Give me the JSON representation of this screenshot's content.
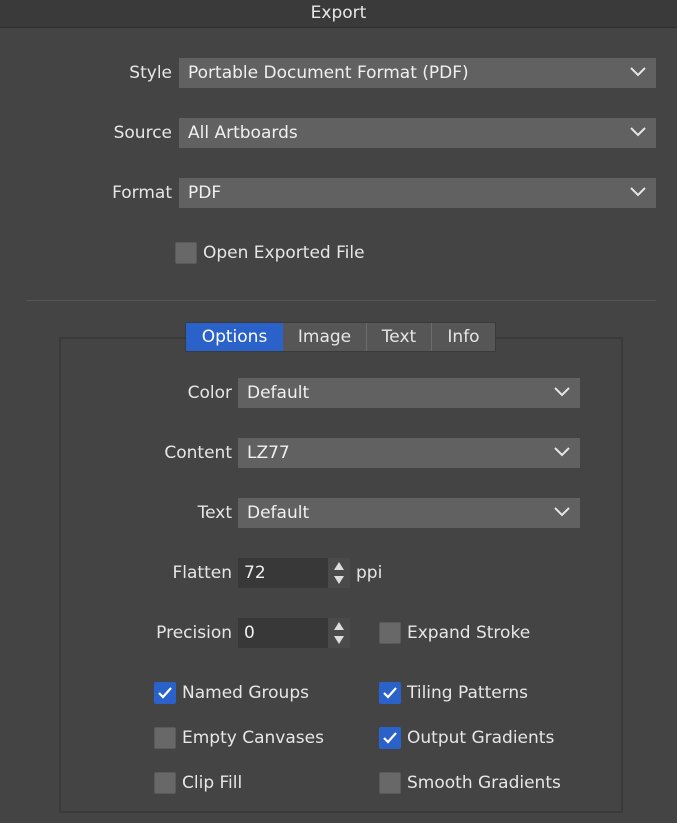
{
  "window": {
    "title": "Export"
  },
  "top": {
    "style": {
      "label": "Style",
      "value": "Portable Document Format (PDF)"
    },
    "source": {
      "label": "Source",
      "value": "All Artboards"
    },
    "format": {
      "label": "Format",
      "value": "PDF"
    },
    "open_exported": {
      "label": "Open Exported File",
      "checked": false
    }
  },
  "tabs": [
    {
      "label": "Options",
      "active": true
    },
    {
      "label": "Image",
      "active": false
    },
    {
      "label": "Text",
      "active": false
    },
    {
      "label": "Info",
      "active": false
    }
  ],
  "options": {
    "color": {
      "label": "Color",
      "value": "Default"
    },
    "content": {
      "label": "Content",
      "value": "LZ77"
    },
    "text": {
      "label": "Text",
      "value": "Default"
    },
    "flatten": {
      "label": "Flatten",
      "value": "72",
      "unit": "ppi"
    },
    "precision": {
      "label": "Precision",
      "value": "0"
    },
    "expand_stroke": {
      "label": "Expand Stroke",
      "checked": false
    },
    "named_groups": {
      "label": "Named Groups",
      "checked": true
    },
    "tiling_patterns": {
      "label": "Tiling Patterns",
      "checked": true
    },
    "empty_canvases": {
      "label": "Empty Canvases",
      "checked": false
    },
    "output_gradients": {
      "label": "Output Gradients",
      "checked": true
    },
    "clip_fill": {
      "label": "Clip Fill",
      "checked": false
    },
    "smooth_gradients": {
      "label": "Smooth Gradients",
      "checked": false
    }
  },
  "colors": {
    "accent": "#2a62c9",
    "background": "#444444",
    "dropdown": "#616161"
  },
  "icons": {
    "dropdown": "chevron-down-icon",
    "check": "checkmark-icon",
    "spinner": "spinner-arrows-icon"
  }
}
